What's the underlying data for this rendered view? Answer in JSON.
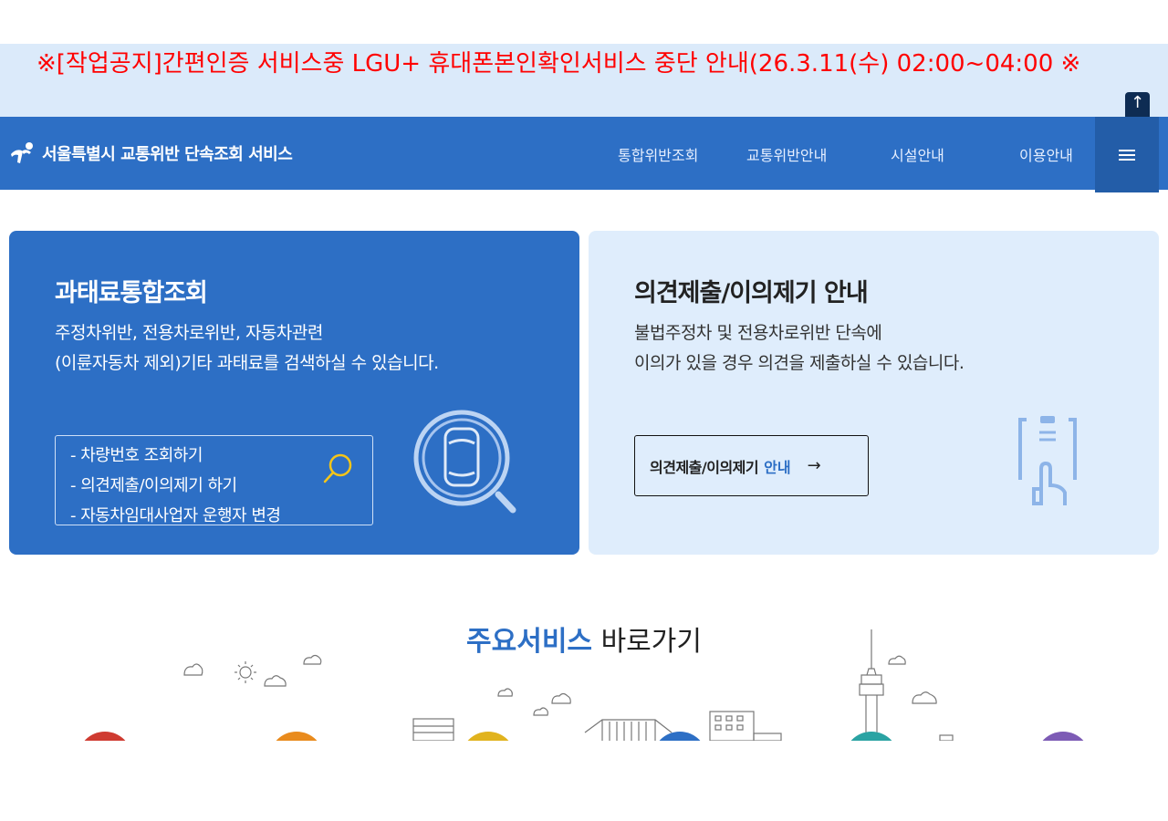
{
  "notice": {
    "text": "※[작업공지]간편인증 서비스중 LGU+ 휴대폰본인확인서비스 중단 안내(26.3.11(수) 02:00~04:00 ※"
  },
  "top_button": {
    "label": "↑"
  },
  "header": {
    "logo_text": "서울특별시 교통위반 단속조회 서비스",
    "nav": [
      "통합위반조회",
      "교통위반안내",
      "시설안내",
      "이용안내"
    ]
  },
  "card_fine": {
    "title": "과태료통합조회",
    "desc_line1": "주정차위반, 전용차로위반, 자동차관련",
    "desc_line2": "(이륜자동차 제외)기타 과태료를 검색하실 수 있습니다.",
    "links": [
      "- 차량번호 조회하기",
      "- 의견제출/이의제기 하기",
      "- 자동차임대사업자 운행자 변경"
    ]
  },
  "card_objection": {
    "title": "의견제출/이의제기 안내",
    "desc_line1": "불법주정차 및 전용차로위반 단속에",
    "desc_line2": "이의가 있을 경우 의견을 제출하실 수 있습니다.",
    "button_label": "의견제출/이의제기",
    "button_accent": "안내",
    "button_arrow": "→"
  },
  "main_services": {
    "title_strong": "주요서비스",
    "title_rest": "바로가기"
  },
  "colors": {
    "notice_bg": "#dbeafa",
    "notice_text": "#ff0000",
    "primary": "#2d6fc5",
    "light_card": "#dfedfc",
    "menu_button": "#235da8",
    "top_button": "#0e2c53"
  },
  "icons": [
    "app-logo-icon",
    "menu-icon",
    "search-icon",
    "car-search-icon",
    "clipboard-hand-icon",
    "arrow-right-icon",
    "arrow-up-icon"
  ]
}
